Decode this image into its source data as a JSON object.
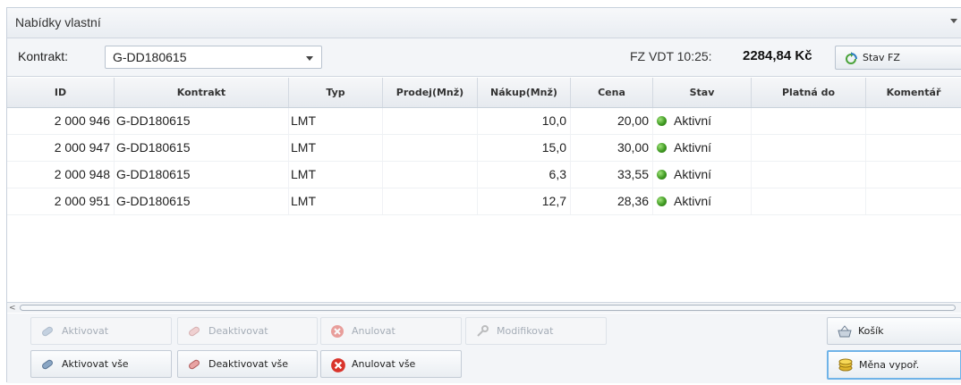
{
  "panel": {
    "title": "Nabídky vlastní"
  },
  "toolbar": {
    "kontrakt_label": "Kontrakt:",
    "kontrakt_value": "G-DD180615",
    "fz_label": "FZ VDT 10:25:",
    "fz_value": "2284,84 Kč",
    "stav_fz_button": "Stav FZ"
  },
  "grid": {
    "columns": [
      "ID",
      "Kontrakt",
      "Typ",
      "Prodej(Mnž)",
      "Nákup(Mnž)",
      "Cena",
      "Stav",
      "Platná do",
      "Komentář"
    ],
    "rows": [
      {
        "id": "2 000 946",
        "kontrakt": "G-DD180615",
        "typ": "LMT",
        "prodej": "",
        "nakup": "10,0",
        "cena": "20,00",
        "stav": "Aktivní",
        "platna": "",
        "komentar": ""
      },
      {
        "id": "2 000 947",
        "kontrakt": "G-DD180615",
        "typ": "LMT",
        "prodej": "",
        "nakup": "15,0",
        "cena": "30,00",
        "stav": "Aktivní",
        "platna": "",
        "komentar": ""
      },
      {
        "id": "2 000 948",
        "kontrakt": "G-DD180615",
        "typ": "LMT",
        "prodej": "",
        "nakup": "6,3",
        "cena": "33,55",
        "stav": "Aktivní",
        "platna": "",
        "komentar": ""
      },
      {
        "id": "2 000 951",
        "kontrakt": "G-DD180615",
        "typ": "LMT",
        "prodej": "",
        "nakup": "12,7",
        "cena": "28,36",
        "stav": "Aktivní",
        "platna": "",
        "komentar": ""
      }
    ]
  },
  "actions": {
    "aktivovat": "Aktivovat",
    "deaktivovat": "Deaktivovat",
    "anulovat": "Anulovat",
    "modifikovat": "Modifikovat",
    "kosik": "Košík",
    "aktivovat_vse": "Aktivovat vše",
    "deaktivovat_vse": "Deaktivovat vše",
    "anulovat_vse": "Anulovat vše",
    "mena_vypor": "Měna vypoř."
  },
  "colors": {
    "status_active": "#3f9a22",
    "cancel_red": "#d9342b",
    "focus_border": "#6fb3e8"
  }
}
